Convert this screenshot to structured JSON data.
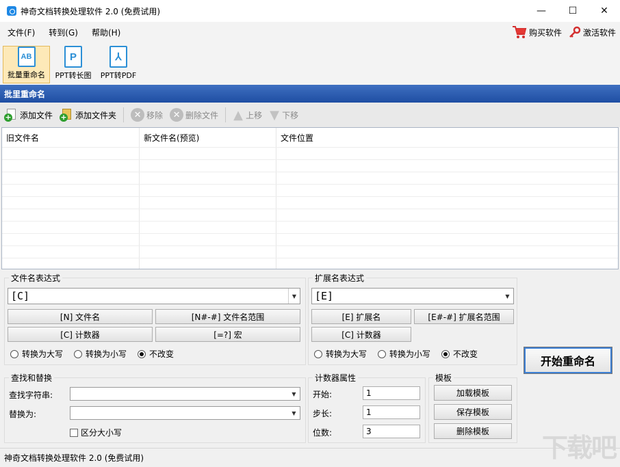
{
  "window": {
    "title": "神奇文档转换处理软件 2.0 (免费试用)",
    "controls": {
      "minimize": "—",
      "maximize": "☐",
      "close": "✕"
    }
  },
  "menu": {
    "items": [
      {
        "label": "文件(F)"
      },
      {
        "label": "转到(G)"
      },
      {
        "label": "帮助(H)"
      }
    ],
    "buy_label": "购买软件",
    "activate_label": "激活软件"
  },
  "big_toolbar": {
    "items": [
      {
        "label": "批量重命名",
        "icon": "rename-icon",
        "glyph": "AB",
        "active": true
      },
      {
        "label": "PPT转长图",
        "icon": "ppt-icon",
        "glyph": "P",
        "active": false
      },
      {
        "label": "PPT转PDF",
        "icon": "pdf-icon",
        "glyph": "⅄",
        "active": false
      }
    ]
  },
  "section": {
    "title": "批里重命名"
  },
  "small_toolbar": {
    "add_file": "添加文件",
    "add_folder": "添加文件夹",
    "remove": "移除",
    "delete_file": "删除文件",
    "move_up": "上移",
    "move_down": "下移"
  },
  "file_list": {
    "columns": [
      {
        "label": "旧文件名"
      },
      {
        "label": "新文件名(预览)"
      },
      {
        "label": "文件位置"
      }
    ]
  },
  "filename_expr": {
    "title": "文件名表达式",
    "value": "[C]",
    "buttons": {
      "name": "[N] 文件名",
      "name_range": "[N#-#] 文件名范围",
      "counter": "[C] 计数器",
      "macro": "[=?] 宏"
    },
    "case": {
      "upper": "转换为大写",
      "lower": "转换为小写",
      "keep": "不改变",
      "selected": "keep"
    }
  },
  "ext_expr": {
    "title": "扩展名表达式",
    "value": "[E]",
    "buttons": {
      "ext": "[E] 扩展名",
      "ext_range": "[E#-#] 扩展名范围",
      "counter": "[C] 计数器"
    },
    "case": {
      "upper": "转换为大写",
      "lower": "转换为小写",
      "keep": "不改变",
      "selected": "keep"
    }
  },
  "find_replace": {
    "title": "查找和替换",
    "find_label": "查找字符串:",
    "find_value": "",
    "replace_label": "替换为:",
    "replace_value": "",
    "case_sensitive_label": "区分大小写",
    "case_sensitive": false
  },
  "counter": {
    "title": "计数器属性",
    "start_label": "开始:",
    "start_value": "1",
    "step_label": "步长:",
    "step_value": "1",
    "digits_label": "位数:",
    "digits_value": "3"
  },
  "template": {
    "title": "模板",
    "load": "加载模板",
    "save": "保存模板",
    "delete": "删除模板"
  },
  "start_button": "开始重命名",
  "status_text": "神奇文档转换处理软件 2.0 (免费试用)",
  "watermark": "下载吧",
  "colors": {
    "header_blue": "#1f4ea3",
    "accent_blue": "#2b8fd6",
    "active_tab": "#fde9b8"
  }
}
